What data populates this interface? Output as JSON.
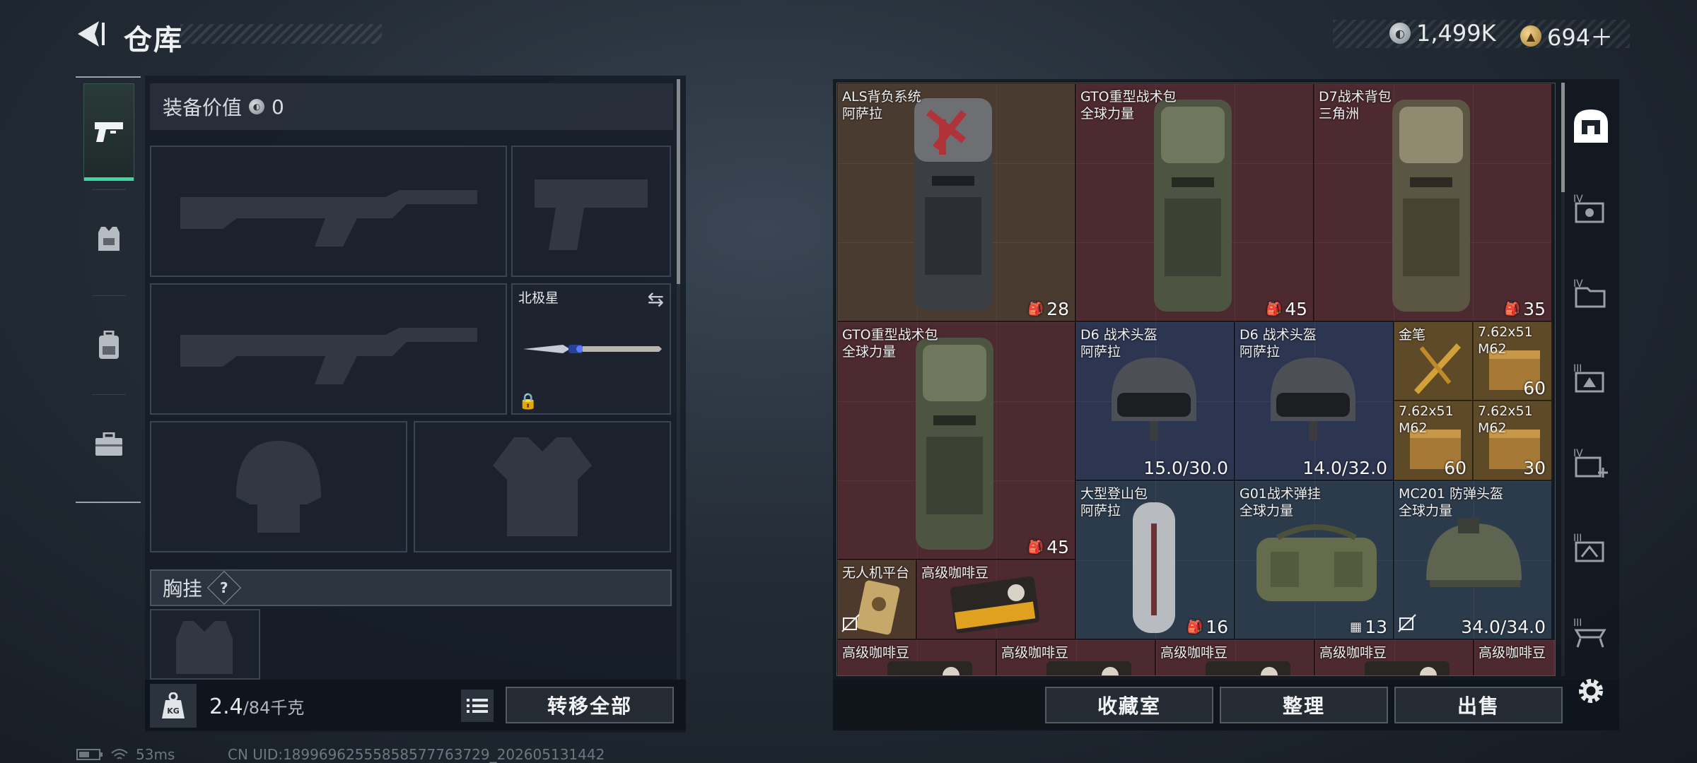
{
  "header": {
    "title": "仓库",
    "currency": [
      {
        "icon": "silver-coin-icon",
        "value": "1,499K"
      },
      {
        "icon": "gold-coin-icon",
        "value": "694＋"
      }
    ]
  },
  "sidebar": {
    "categories": [
      {
        "icon": "pistol-icon",
        "active": true
      },
      {
        "icon": "armor-vest-icon",
        "active": false
      },
      {
        "icon": "backpack-icon",
        "active": false
      },
      {
        "icon": "toolbox-icon",
        "active": false
      }
    ]
  },
  "equipment": {
    "value_label": "装备价值",
    "value_amount": "0",
    "melee_slot": {
      "label": "北极星"
    },
    "chest_rig_label": "胸挂",
    "chest_rig_help": "?",
    "weight_current": "2.4",
    "weight_max": "/84千克",
    "transfer_all_label": "转移全部"
  },
  "storage": {
    "items": [
      {
        "name": "ALS背负系统",
        "sub": "阿萨拉",
        "value": "28",
        "color": "brown"
      },
      {
        "name": "GTO重型战术包",
        "sub": "全球力量",
        "value": "45",
        "color": "red"
      },
      {
        "name": "D7战术背包",
        "sub": "三角洲",
        "value": "35",
        "color": "red"
      },
      {
        "name": "GTO重型战术包",
        "sub": "全球力量",
        "value": "45",
        "color": "red"
      },
      {
        "name": "D6 战术头盔",
        "sub": "阿萨拉",
        "value": "15.0/30.0",
        "color": "blue"
      },
      {
        "name": "D6 战术头盔",
        "sub": "阿萨拉",
        "value": "14.0/32.0",
        "color": "blue"
      },
      {
        "name": "金笔",
        "sub": "",
        "value": "",
        "color": "gold"
      },
      {
        "name": "7.62x51",
        "sub": "M62",
        "value": "60",
        "color": "gold"
      },
      {
        "name": "7.62x51",
        "sub": "M62",
        "value": "60",
        "color": "gold"
      },
      {
        "name": "7.62x51",
        "sub": "M62",
        "value": "30",
        "color": "gold"
      },
      {
        "name": "大型登山包",
        "sub": "阿萨拉",
        "value": "16",
        "color": "teal"
      },
      {
        "name": "G01战术弹挂",
        "sub": "全球力量",
        "value": "13",
        "color": "teal"
      },
      {
        "name": "MC201 防弹头盔",
        "sub": "全球力量",
        "value": "34.0/34.0",
        "color": "teal"
      },
      {
        "name": "无人机平台",
        "sub": "",
        "value": "",
        "color": "gold"
      },
      {
        "name": "高级咖啡豆",
        "sub": "",
        "value": "",
        "color": "red"
      },
      {
        "name": "高级咖啡豆",
        "sub": "",
        "value": "",
        "color": "red"
      },
      {
        "name": "高级咖啡豆",
        "sub": "",
        "value": "",
        "color": "red"
      },
      {
        "name": "高级咖啡豆",
        "sub": "",
        "value": "",
        "color": "red"
      },
      {
        "name": "高级咖啡豆",
        "sub": "",
        "value": "",
        "color": "red"
      },
      {
        "name": "高级咖啡豆",
        "sub": "",
        "value": "",
        "color": "red"
      }
    ],
    "buttons": {
      "collection": "收藏室",
      "sort": "整理",
      "sell": "出售"
    },
    "nav_icons": [
      "home-icon",
      "storage-tier-4-icon",
      "storage-tier-4-folder-icon",
      "storage-tier-3-icon",
      "storage-tier-4-add-icon",
      "storage-tier-3-alt-icon",
      "storage-tier-3-rack-icon",
      "settings-icon"
    ]
  },
  "status": {
    "ping": "53ms",
    "uid": "CN UID:18996962555858577763729_202605131442"
  },
  "colors": {
    "accent": "#3fd6a0",
    "brown": "#4a3b30",
    "red": "#4d2a2f",
    "blue": "#2d3650",
    "gold": "#5f4a28",
    "teal": "#2c3b4b"
  }
}
